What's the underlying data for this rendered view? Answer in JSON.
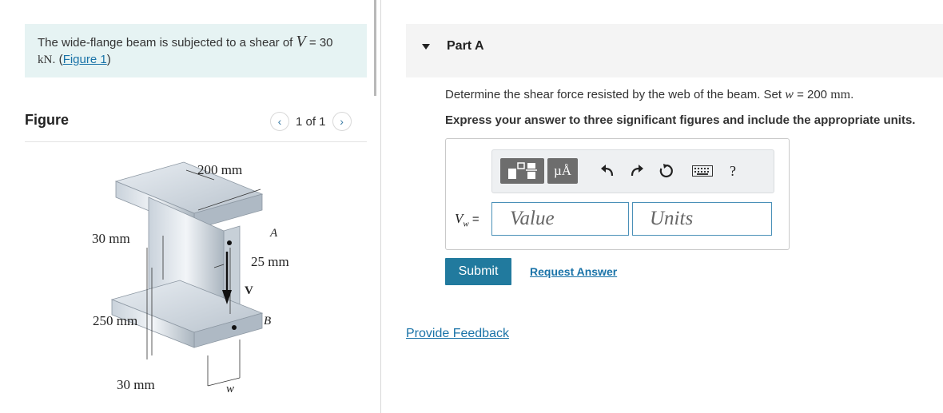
{
  "problem": {
    "text_before": "The wide-flange beam is subjected to a shear of",
    "variable": "V",
    "equals": " = 30",
    "unit": "kN",
    "paren_open": ". (",
    "figure_link": "Figure 1",
    "paren_close": ")"
  },
  "figure_panel": {
    "title": "Figure",
    "counter": "1 of 1",
    "labels": {
      "top_width": "200 mm",
      "point_a": "A",
      "flange_top": "30 mm",
      "web_thickness": "25 mm",
      "shear": "V",
      "web_depth": "250 mm",
      "point_b": "B",
      "flange_bottom": "30 mm",
      "w": "w"
    }
  },
  "part": {
    "title": "Part A",
    "question_before": "Determine the shear force resisted by the web of the beam. Set",
    "question_var": "w",
    "question_after": " = 200",
    "question_unit": "mm",
    "question_end": ".",
    "instruction": "Express your answer to three significant figures and include the appropriate units."
  },
  "answer": {
    "variable": "V",
    "subscript": "w",
    "equals": " =",
    "value_placeholder": "Value",
    "units_placeholder": "Units"
  },
  "toolbar": {
    "units_symbol": "µÅ",
    "help": "?"
  },
  "actions": {
    "submit": "Submit",
    "request_answer": "Request Answer",
    "feedback": "Provide Feedback"
  },
  "colors": {
    "accent": "#217a9e",
    "link": "#1a73a8",
    "problem_bg": "#e6f3f3"
  }
}
